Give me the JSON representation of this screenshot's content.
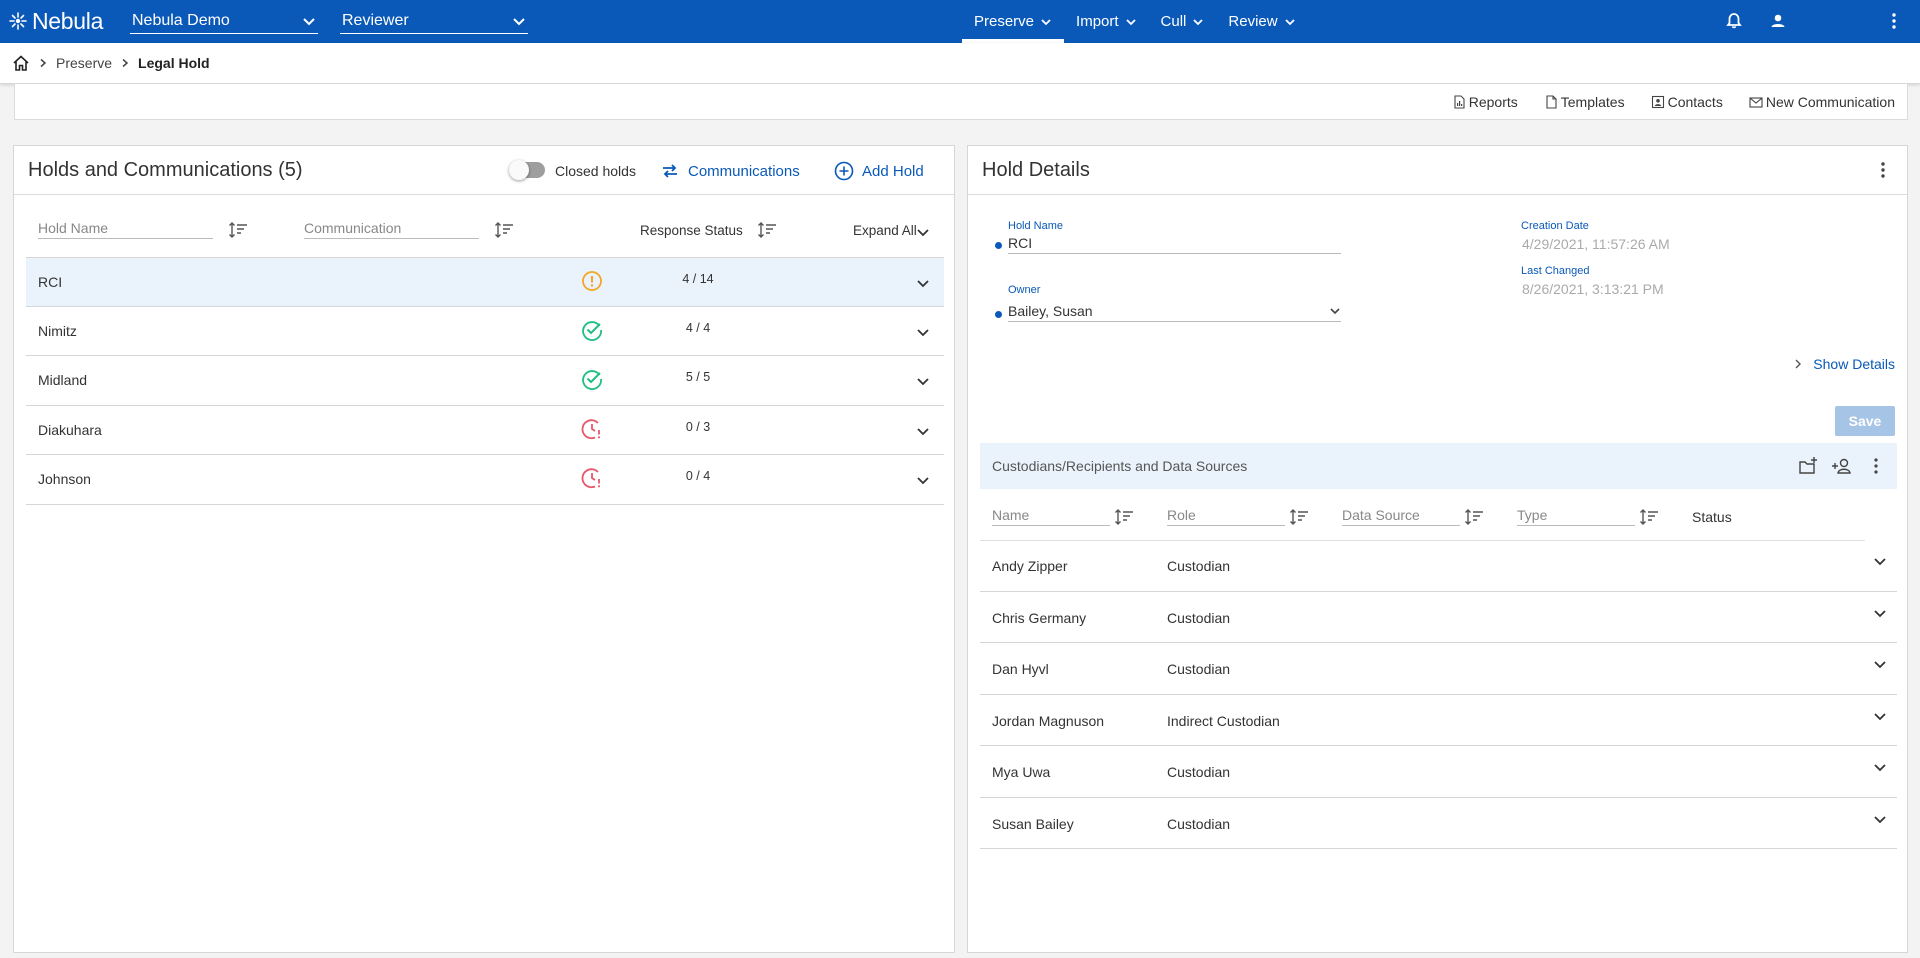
{
  "app": {
    "logo_text": "Nebula",
    "project_select": "Nebula Demo",
    "role_select": "Reviewer",
    "nav": [
      {
        "label": "Preserve",
        "active": true
      },
      {
        "label": "Import",
        "active": false
      },
      {
        "label": "Cull",
        "active": false
      },
      {
        "label": "Review",
        "active": false
      }
    ],
    "accent_color": "#0a59b8"
  },
  "breadcrumb": {
    "parent": "Preserve",
    "current": "Legal Hold"
  },
  "toolbar": {
    "reports": "Reports",
    "templates": "Templates",
    "contacts": "Contacts",
    "new_communication": "New Communication"
  },
  "holds": {
    "title": "Holds and Communications (5)",
    "closed_toggle_label": "Closed holds",
    "communications_label": "Communications",
    "add_hold_label": "Add Hold",
    "columns": {
      "hold_name": "Hold Name",
      "communication": "Communication",
      "response_status": "Response Status",
      "expand_all": "Expand All"
    },
    "rows": [
      {
        "name": "RCI",
        "status": "warning",
        "count": "4 / 14",
        "selected": true
      },
      {
        "name": "Nimitz",
        "status": "complete",
        "count": "4 / 4",
        "selected": false
      },
      {
        "name": "Midland",
        "status": "complete",
        "count": "5 / 5",
        "selected": false
      },
      {
        "name": "Diakuhara",
        "status": "overdue",
        "count": "0 / 3",
        "selected": false
      },
      {
        "name": "Johnson",
        "status": "overdue",
        "count": "0 / 4",
        "selected": false
      }
    ]
  },
  "details": {
    "title": "Hold Details",
    "hold_name_label": "Hold Name",
    "hold_name_value": "RCI",
    "owner_label": "Owner",
    "owner_value": "Bailey, Susan",
    "creation_date_label": "Creation Date",
    "creation_date_value": "4/29/2021, 11:57:26 AM",
    "last_changed_label": "Last Changed",
    "last_changed_value": "8/26/2021, 3:13:21 PM",
    "show_details_label": "Show Details",
    "save_label": "Save"
  },
  "custodians": {
    "title": "Custodians/Recipients and Data Sources",
    "columns": {
      "name": "Name",
      "role": "Role",
      "data_source": "Data Source",
      "type": "Type",
      "status": "Status"
    },
    "rows": [
      {
        "name": "Andy Zipper",
        "role": "Custodian"
      },
      {
        "name": "Chris Germany",
        "role": "Custodian"
      },
      {
        "name": "Dan Hyvl",
        "role": "Custodian"
      },
      {
        "name": "Jordan Magnuson",
        "role": "Indirect Custodian"
      },
      {
        "name": "Mya Uwa",
        "role": "Custodian"
      },
      {
        "name": "Susan Bailey",
        "role": "Custodian"
      }
    ]
  }
}
